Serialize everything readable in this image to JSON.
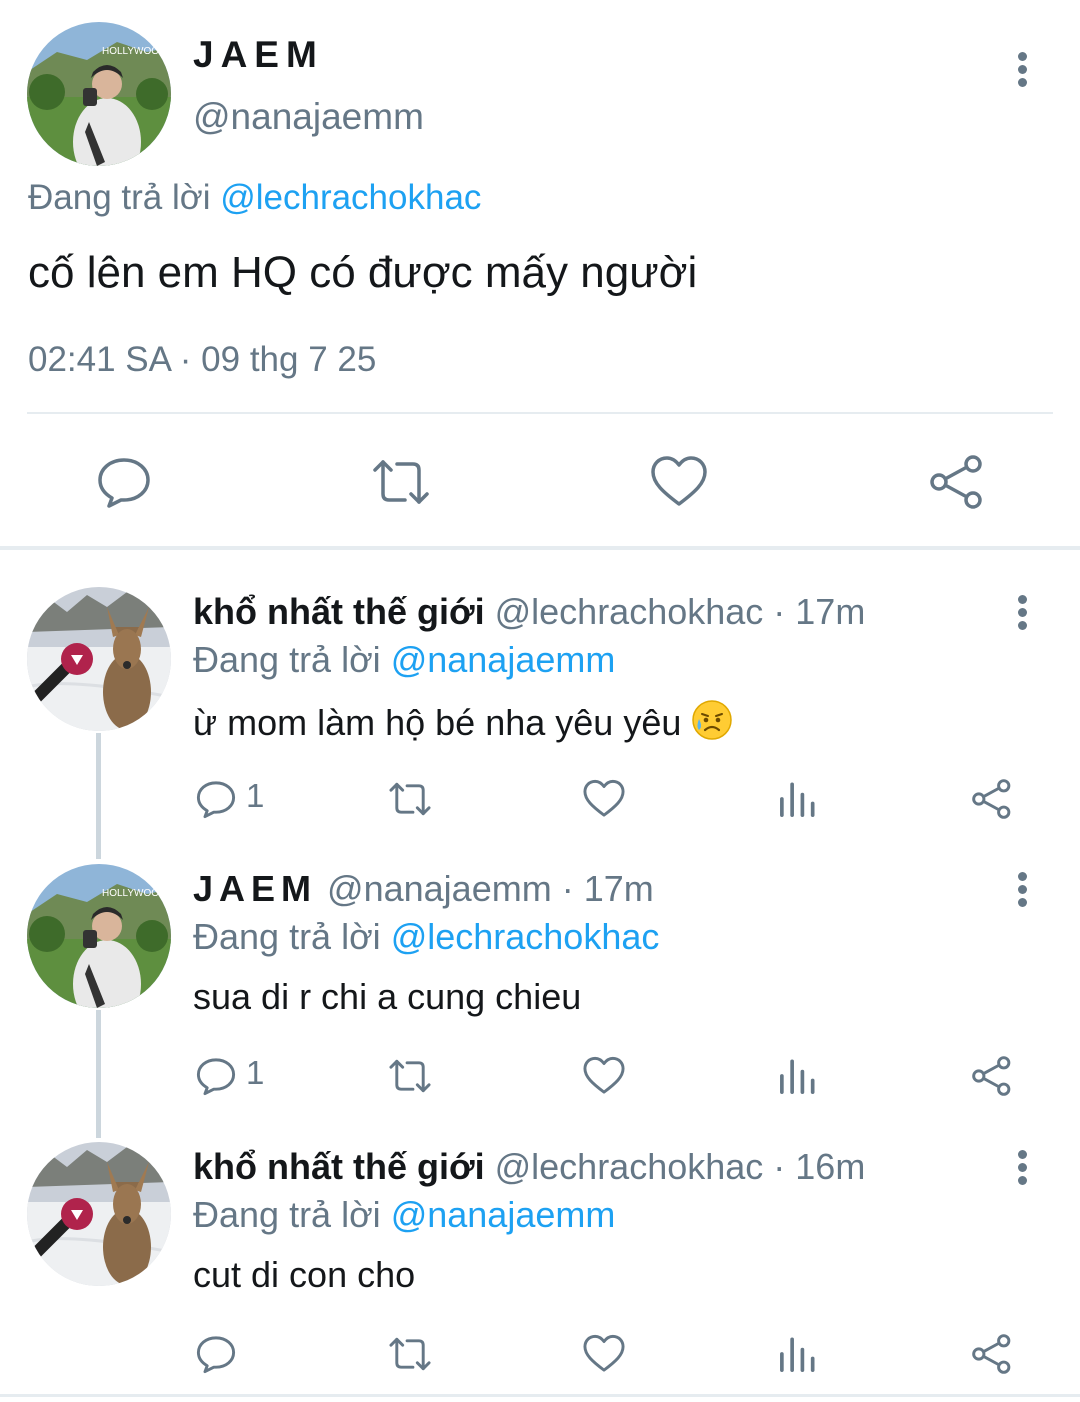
{
  "main_tweet": {
    "name": "JAEM",
    "handle": "@nanajaemm",
    "replying_prefix": "Đang trả lời ",
    "replying_to": "@lechrachokhac",
    "text": "cố lên em HQ có được mấy người",
    "timestamp": "02:41 SA · 09 thg 7 25",
    "icons": [
      "reply-icon",
      "retweet-icon",
      "like-icon",
      "share-icon"
    ]
  },
  "replies": [
    {
      "name": "khổ nhất thế giới",
      "handle": "@lechrachokhac",
      "time": " · 17m",
      "replying_prefix": "Đang trả lời ",
      "replying_to": "@nanajaemm",
      "text": "ừ mom làm hộ bé nha yêu yêu ",
      "emoji": "sad-but-relieved-face",
      "reply_count": "1"
    },
    {
      "name": "JAEM",
      "handle": "@nanajaemm",
      "time": " · 17m",
      "replying_prefix": "Đang trả lời ",
      "replying_to": "@lechrachokhac",
      "text": "sua di r chi a cung chieu",
      "reply_count": "1"
    },
    {
      "name": "khổ nhất thế giới",
      "handle": "@lechrachokhac",
      "time": " · 16m",
      "replying_prefix": "Đang trả lời ",
      "replying_to": "@nanajaemm",
      "text": "cut di con cho",
      "reply_count": ""
    }
  ],
  "colors": {
    "accent": "#1da1f2",
    "secondary_text": "#657786",
    "icon": "#657786",
    "divider": "#e6ecf0"
  }
}
